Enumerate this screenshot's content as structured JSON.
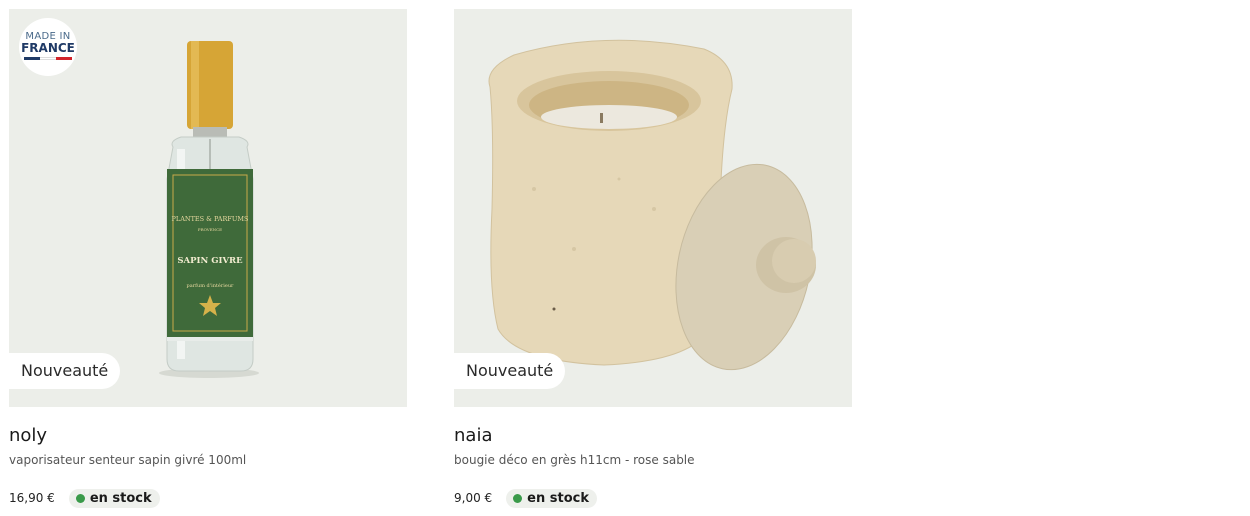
{
  "products": [
    {
      "badge": "Nouveauté",
      "origin_badge": {
        "line1": "MADE IN",
        "line2": "FRANCE",
        "flag_colors": [
          "#1f3a66",
          "#ffffff",
          "#d2232a"
        ]
      },
      "name": "noly",
      "description": "vaporisateur senteur sapin givré 100ml",
      "price": "16,90 €",
      "stock": "en stock",
      "label_text": {
        "brand": "PLANTES & PARFUMS",
        "region": "PROVENCE",
        "scent": "SAPIN GIVRE",
        "type": "parfum d'intérieur"
      },
      "image": "green-room-spray-bottle"
    },
    {
      "badge": "Nouveauté",
      "name": "naia",
      "description": "bougie déco en grès h11cm - rose sable",
      "price": "9,00 €",
      "stock": "en stock",
      "image": "sand-stoneware-candle-jar"
    }
  ],
  "colors": {
    "stock_dot": "#3a9a4a",
    "image_bg": "#eceee9"
  }
}
